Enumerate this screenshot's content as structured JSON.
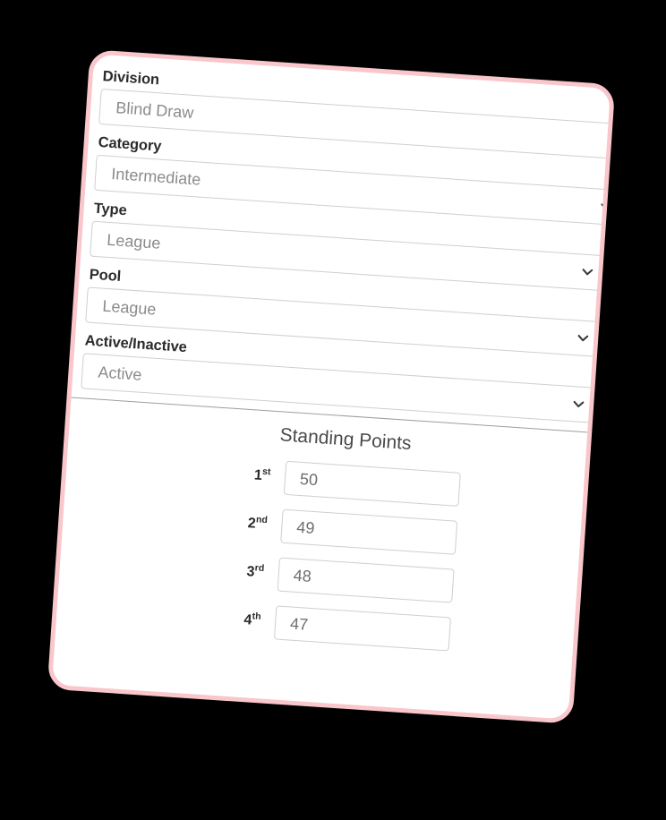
{
  "theme": {
    "page_background": "#000000",
    "card_background": "#ffffff",
    "card_border": "#f9c6cb",
    "label_color": "#2b2b2b",
    "value_color": "#8b8b8b",
    "input_border": "#cfcfcf",
    "divider_color": "#9e9e9e"
  },
  "form": {
    "fields": [
      {
        "label": "Division",
        "value": "Blind Draw",
        "icon": "chevron-down-icon",
        "name": "division"
      },
      {
        "label": "Category",
        "value": "Intermediate",
        "icon": "chevron-down-icon",
        "name": "category"
      },
      {
        "label": "Type",
        "value": "League",
        "icon": "chevron-down-icon",
        "name": "type"
      },
      {
        "label": "Pool",
        "value": "League",
        "icon": "chevron-down-icon",
        "name": "pool"
      },
      {
        "label": "Active/Inactive",
        "value": "Active",
        "icon": "chevron-down-icon",
        "name": "active-inactive"
      }
    ]
  },
  "standing_points": {
    "title": "Standing Points",
    "rows": [
      {
        "place": "1",
        "suffix": "st",
        "value": "50"
      },
      {
        "place": "2",
        "suffix": "nd",
        "value": "49"
      },
      {
        "place": "3",
        "suffix": "rd",
        "value": "48"
      },
      {
        "place": "4",
        "suffix": "th",
        "value": "47"
      }
    ]
  }
}
